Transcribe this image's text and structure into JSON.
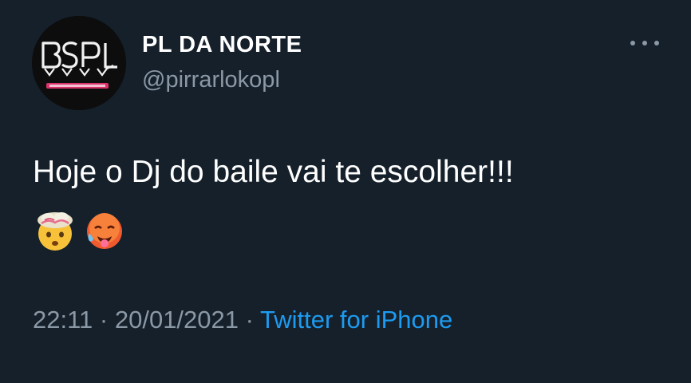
{
  "tweet": {
    "display_name": "PL DA NORTE",
    "handle": "@pirrarlokopl",
    "text": "Hoje o Dj do baile vai te escolher!!!",
    "emojis": [
      "exploding-head-emoji",
      "hot-face-emoji"
    ],
    "time": "22:11",
    "separator": "·",
    "date": "20/01/2021",
    "source": "Twitter for iPhone",
    "avatar_logo_text": "BSPL"
  },
  "colors": {
    "background": "#15202b",
    "primary_text": "#ffffff",
    "secondary_text": "#8b98a5",
    "link": "#1d9bf0"
  }
}
